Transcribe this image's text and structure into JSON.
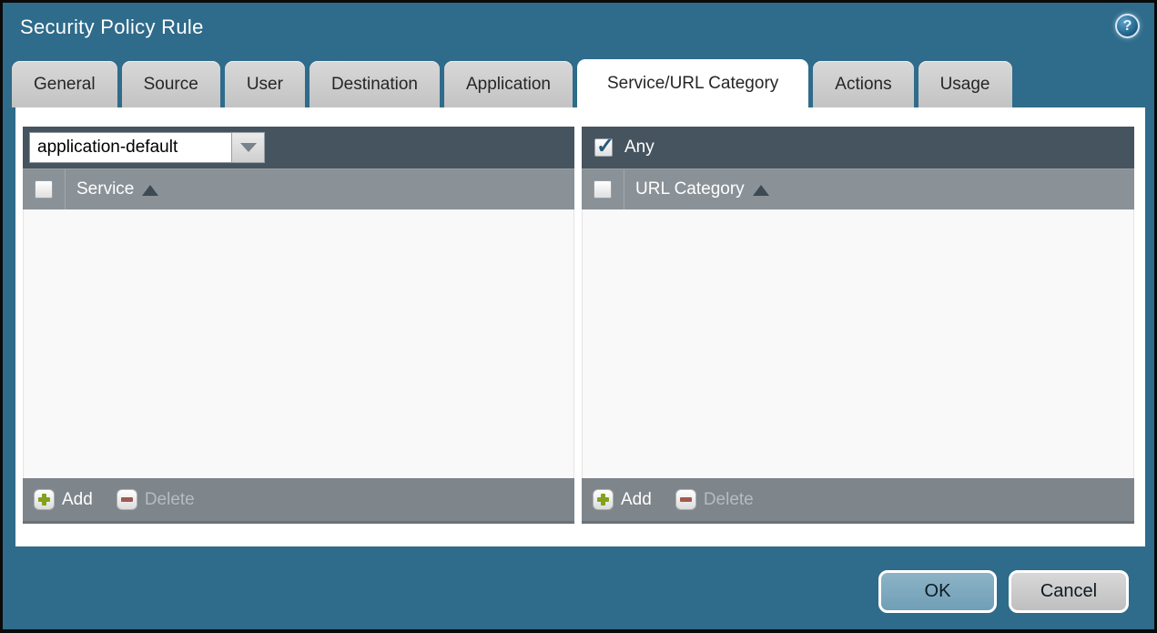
{
  "dialog": {
    "title": "Security Policy Rule",
    "help_icon": "?"
  },
  "tabs": [
    {
      "label": "General",
      "active": false
    },
    {
      "label": "Source",
      "active": false
    },
    {
      "label": "User",
      "active": false
    },
    {
      "label": "Destination",
      "active": false
    },
    {
      "label": "Application",
      "active": false
    },
    {
      "label": "Service/URL Category",
      "active": true
    },
    {
      "label": "Actions",
      "active": false
    },
    {
      "label": "Usage",
      "active": false
    }
  ],
  "service_panel": {
    "dropdown_value": "application-default",
    "column_header": "Service",
    "header_checkbox_checked": false,
    "sort": "ascending",
    "rows": [],
    "add_label": "Add",
    "delete_label": "Delete",
    "delete_enabled": false
  },
  "url_panel": {
    "any_label": "Any",
    "any_checked": true,
    "column_header": "URL Category",
    "header_checkbox_checked": false,
    "sort": "ascending",
    "rows": [],
    "add_label": "Add",
    "delete_label": "Delete",
    "delete_enabled": false
  },
  "footer": {
    "ok_label": "OK",
    "cancel_label": "Cancel"
  },
  "colors": {
    "dialog_background": "#2F6B8A",
    "panel_header": "#46545F",
    "column_header": "#8A9197",
    "panel_footer": "#7E858B",
    "ok_button": "#7BA6BC",
    "cancel_button": "#C9C9C9",
    "check_mark": "#26597A",
    "add_plus": "#84A11C",
    "delete_minus": "#A05A50"
  }
}
